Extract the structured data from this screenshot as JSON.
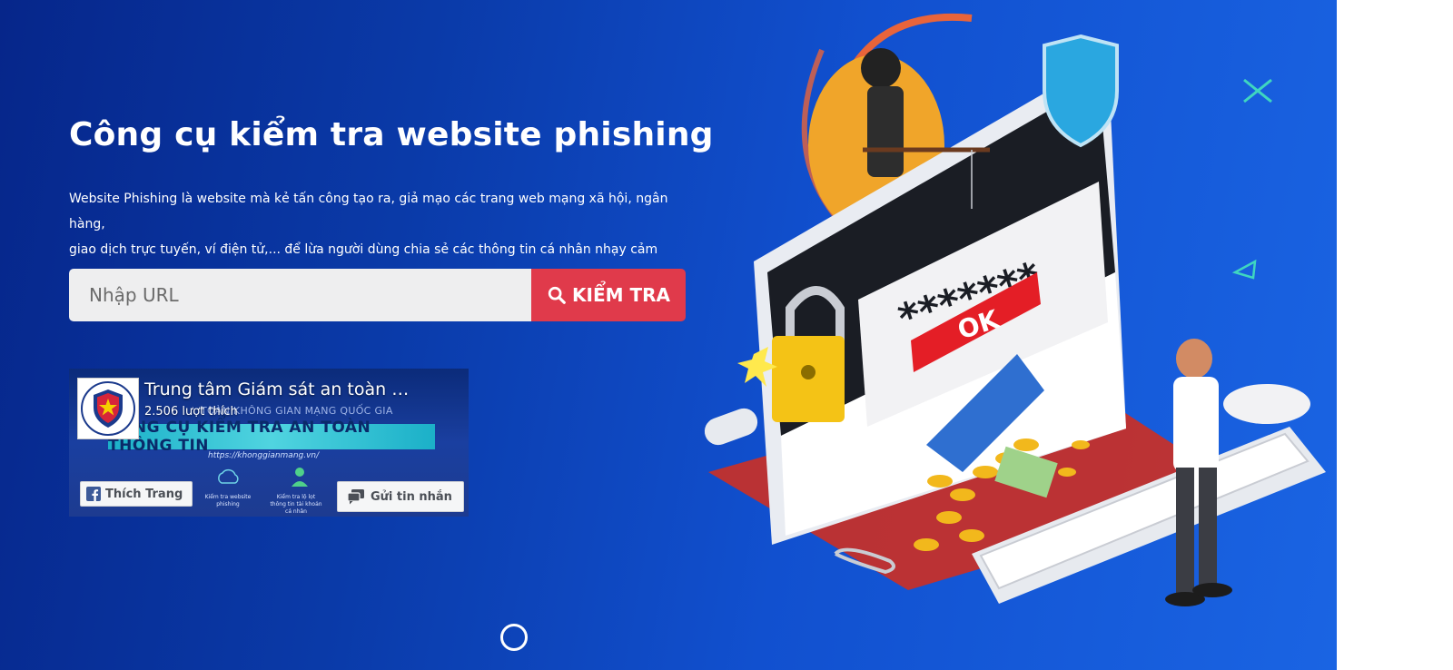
{
  "hero": {
    "title": "Công cụ kiểm tra website phishing",
    "description_line1": "Website Phishing là website mà kẻ tấn công tạo ra, giả mạo các trang web mạng xã hội, ngân hàng,",
    "description_line2": "giao dịch trực tuyến, ví điện tử,... để lừa người dùng chia sẻ các thông tin cá nhân nhạy cảm"
  },
  "search": {
    "placeholder": "Nhập URL",
    "value": "",
    "button_label": "KIỂM TRA",
    "button_color": "#e03a4b"
  },
  "facebook_widget": {
    "page_name": "Trung tâm Giám sát an toàn …",
    "likes": "2.506 lượt thích",
    "like_button": "Thích Trang",
    "message_button": "Gửi tin nhắn",
    "cover_line": "TOÀN KHÔNG GIAN MẠNG QUỐC GIA",
    "cover_banner": "CÔNG CỤ KIỂM TRA AN TOÀN THÔNG TIN",
    "cover_url": "https://khonggianmang.vn/",
    "cover_feature_1": "Kiểm tra website phishing",
    "cover_feature_2": "Kiểm tra lộ lọt thông tin tài khoản cá nhân"
  },
  "illustration": {
    "password_mask": "*******",
    "ok_label": "OK"
  },
  "colors": {
    "background_start": "#06268a",
    "background_end": "#1a64e3",
    "accent": "#e03a4b"
  },
  "icons": [
    "search-icon",
    "facebook-icon",
    "message-icon",
    "scroll-indicator-icon"
  ]
}
